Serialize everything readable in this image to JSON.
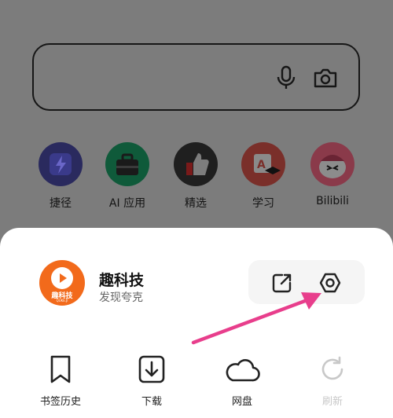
{
  "shortcuts": [
    {
      "label": "捷径",
      "icon": "lightning-icon"
    },
    {
      "label": "AI 应用",
      "icon": "toolbox-icon"
    },
    {
      "label": "精选",
      "icon": "thumbs-up-icon"
    },
    {
      "label": "学习",
      "icon": "graduation-icon"
    },
    {
      "label": "Bilibili",
      "icon": "bilibili-icon"
    }
  ],
  "app": {
    "logo_text": "趣科技",
    "logo_subtext": "QUKE.JI",
    "name": "趣科技",
    "description": "发现夸克"
  },
  "tools": [
    {
      "label": "书签历史",
      "icon": "bookmark-icon",
      "enabled": true
    },
    {
      "label": "下载",
      "icon": "download-icon",
      "enabled": true
    },
    {
      "label": "网盘",
      "icon": "cloud-icon",
      "enabled": true
    },
    {
      "label": "刷新",
      "icon": "refresh-icon",
      "enabled": false
    }
  ],
  "colors": {
    "overlay": "#7c7c7c",
    "annotation_arrow": "#e83e8c",
    "brand_orange": "#f26a1b"
  }
}
